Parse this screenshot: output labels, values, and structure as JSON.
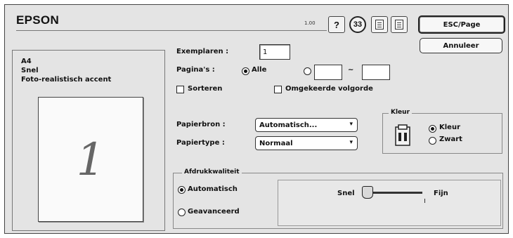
{
  "header": {
    "brand": "EPSON",
    "version": "1.00",
    "help_label": "?",
    "settings_label": "33",
    "default_button": "ESC/Page",
    "cancel_button": "Annuleer"
  },
  "summary": {
    "paper": "A4",
    "speed": "Snel",
    "mode": "Foto-realistisch accent",
    "page_number": "1"
  },
  "copies": {
    "label": "Exemplaren :",
    "value": "1"
  },
  "pages": {
    "label": "Pagina's :",
    "all_label": "Alle",
    "from": "",
    "to": "",
    "separator": "~"
  },
  "options": {
    "collate_label": "Sorteren",
    "reverse_label": "Omgekeerde volgorde"
  },
  "paper": {
    "source_label": "Papierbron :",
    "source_value": "Automatisch...",
    "type_label": "Papiertype :",
    "type_value": "Normaal"
  },
  "color": {
    "title": "Kleur",
    "option_color": "Kleur",
    "option_black": "Zwart",
    "selected": "Kleur"
  },
  "quality": {
    "title": "Afdrukkwaliteit",
    "option_auto": "Automatisch",
    "option_advanced": "Geavanceerd",
    "selected": "Automatisch",
    "slider_left": "Snel",
    "slider_right": "Fijn",
    "slider_level": 0.0
  },
  "icons": {
    "help": "help-icon",
    "settings": "custom-settings-icon",
    "layout": "page-layout-icon",
    "utility": "utility-icon",
    "printer": "printer-ink-icon",
    "arrows": "stepper-arrows-icon"
  }
}
